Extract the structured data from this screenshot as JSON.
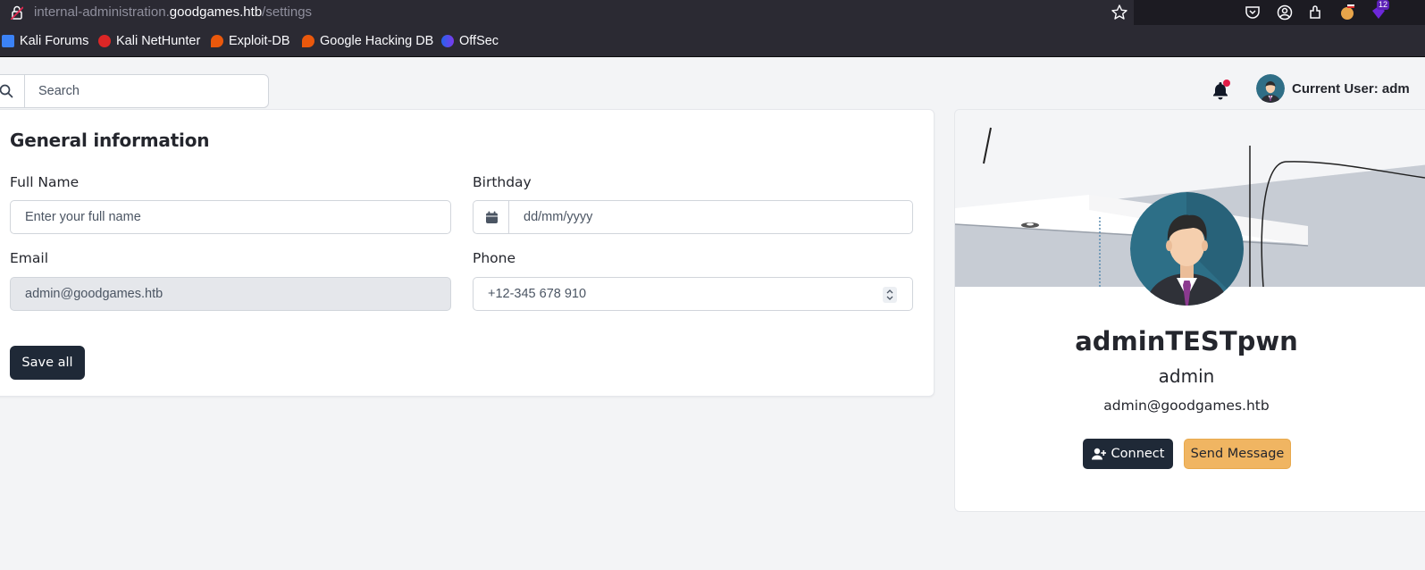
{
  "browser": {
    "url_prefix": "internal-administration.",
    "url_host": "goodgames.htb",
    "url_path": "/settings",
    "extensions_badge": "12",
    "bookmarks": [
      {
        "label": "Kali Forums",
        "icon": "kali-forums-icon"
      },
      {
        "label": "Kali NetHunter",
        "icon": "kali-nethunter-icon"
      },
      {
        "label": "Exploit-DB",
        "icon": "exploit-db-icon"
      },
      {
        "label": "Google Hacking DB",
        "icon": "google-hacking-db-icon"
      },
      {
        "label": "OffSec",
        "icon": "offsec-icon"
      }
    ]
  },
  "topbar": {
    "search_placeholder": "Search",
    "current_user": "Current User: adm"
  },
  "general": {
    "title": "General information",
    "full_name_label": "Full Name",
    "full_name_placeholder": "Enter your full name",
    "birthday_label": "Birthday",
    "birthday_placeholder": "dd/mm/yyyy",
    "email_label": "Email",
    "email_placeholder": "admin@goodgames.htb",
    "phone_label": "Phone",
    "phone_placeholder": "+12-345 678 910",
    "save_label": "Save all"
  },
  "profile": {
    "name": "adminTESTpwn",
    "role": "admin",
    "email": "admin@goodgames.htb",
    "connect_label": "Connect",
    "message_label": "Send Message"
  },
  "colors": {
    "primary": "#1f2937",
    "accent": "#f0b562",
    "notification": "#e11d48"
  }
}
